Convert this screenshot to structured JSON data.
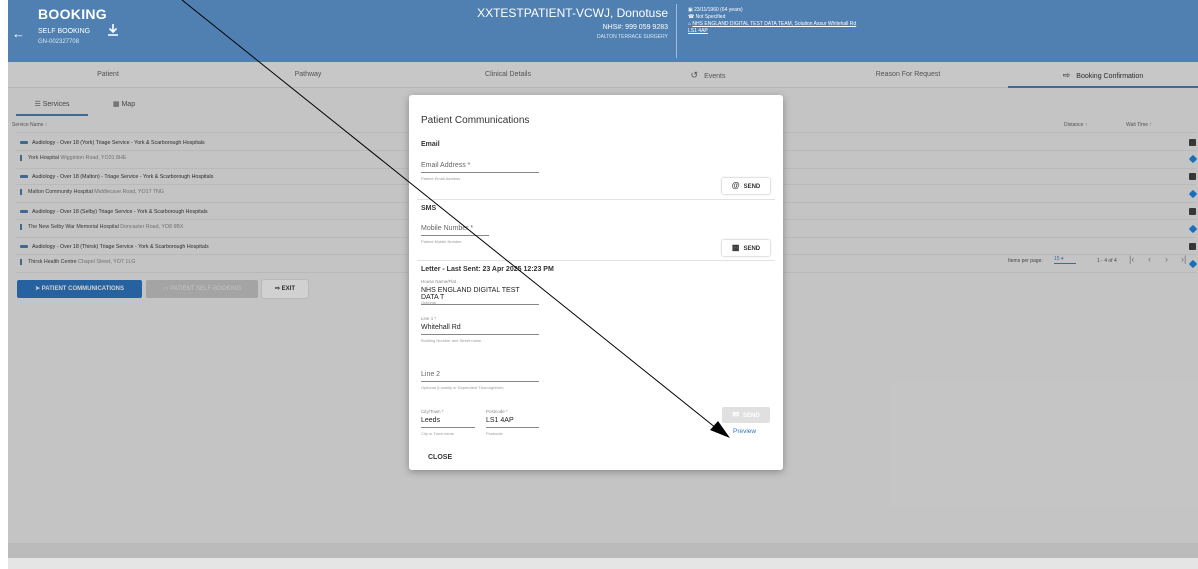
{
  "header": {
    "title": "BOOKING",
    "subtitle": "SELF BOOKING",
    "booking_id": "GN-002327708",
    "patient_name": "XXTESTPATIENT-VCWJ, Donotuse",
    "nhs_number": "NHS#: 999 059 9283",
    "practice": "DALTON TERRACE SURGERY",
    "dob": "23/11/1960 (64 years)",
    "phone": "Not Specified",
    "address_line": "NHS ENGLAND DIGITAL TEST DATA TEAM, Solution Assur Whitehall Rd",
    "postcode": "LS1 4AP"
  },
  "tabs": [
    {
      "label": "Patient"
    },
    {
      "label": "Pathway"
    },
    {
      "label": "Clinical Details"
    },
    {
      "label": "Events"
    },
    {
      "label": "Reason For Request"
    },
    {
      "label": "Booking Confirmation"
    }
  ],
  "subtabs": {
    "services": "Services",
    "map": "Map"
  },
  "columns": {
    "service_name": "Service Name",
    "distance": "Distance",
    "wait_time": "Wait Time"
  },
  "services": [
    {
      "name": "Audiology - Over 18 (York) Triage Service - York & Scarborough Hospitals",
      "site": "York Hospital",
      "address": "Wigginton Road, YO31 8HE"
    },
    {
      "name": "Audiology - Over 18 (Malton) - Triage Service - York & Scarborough Hospitals",
      "site": "Malton Community Hospital",
      "address": "Middlecave Road, YO17 7NG"
    },
    {
      "name": "Audiology - Over 18 (Selby) Triage Service - York & Scarborough Hospitals",
      "site": "The New Selby War Memorial Hospital",
      "address": "Doncaster Road, YO8 9BX"
    },
    {
      "name": "Audiology - Over 18 (Thirsk) Triage Service - York & Scarborough Hospitals",
      "site": "Thirsk Health Centre",
      "address": "Chapel Street, YO7 1LG"
    }
  ],
  "pager": {
    "items_label": "Items per page:",
    "per_page": "15",
    "range": "1 - 4 of 4"
  },
  "actions": {
    "comm": "PATIENT COMMUNICATIONS",
    "self_booking": "PATIENT SELF-BOOKING",
    "exit": "EXIT"
  },
  "modal": {
    "title": "Patient Communications",
    "email_section": "Email",
    "email_placeholder": "Email Address *",
    "email_hint": "Patient Email Address",
    "send_label": "SEND",
    "sms_section": "SMS",
    "mobile_placeholder": "Mobile Number *",
    "mobile_hint": "Patient Mobile Number",
    "letter_section": "Letter - Last Sent: 23 Apr 2025 12:23 PM",
    "house_label": "House Name/Flat",
    "house_value": "NHS ENGLAND DIGITAL TEST DATA T",
    "house_hint": "Optional",
    "line1_label": "Line 1 *",
    "line1_value": "Whitehall Rd",
    "line1_hint": "Building Number and Street name",
    "line2_placeholder": "Line 2",
    "line2_hint": "Optional (Locality or Dependent Thoroughfare)",
    "city_label": "City/Town *",
    "city_value": "Leeds",
    "city_hint": "City or Town name",
    "postcode_label": "Postcode *",
    "postcode_value": "LS1 4AP",
    "postcode_hint": "Postcode",
    "preview": "Preview",
    "close": "CLOSE"
  }
}
